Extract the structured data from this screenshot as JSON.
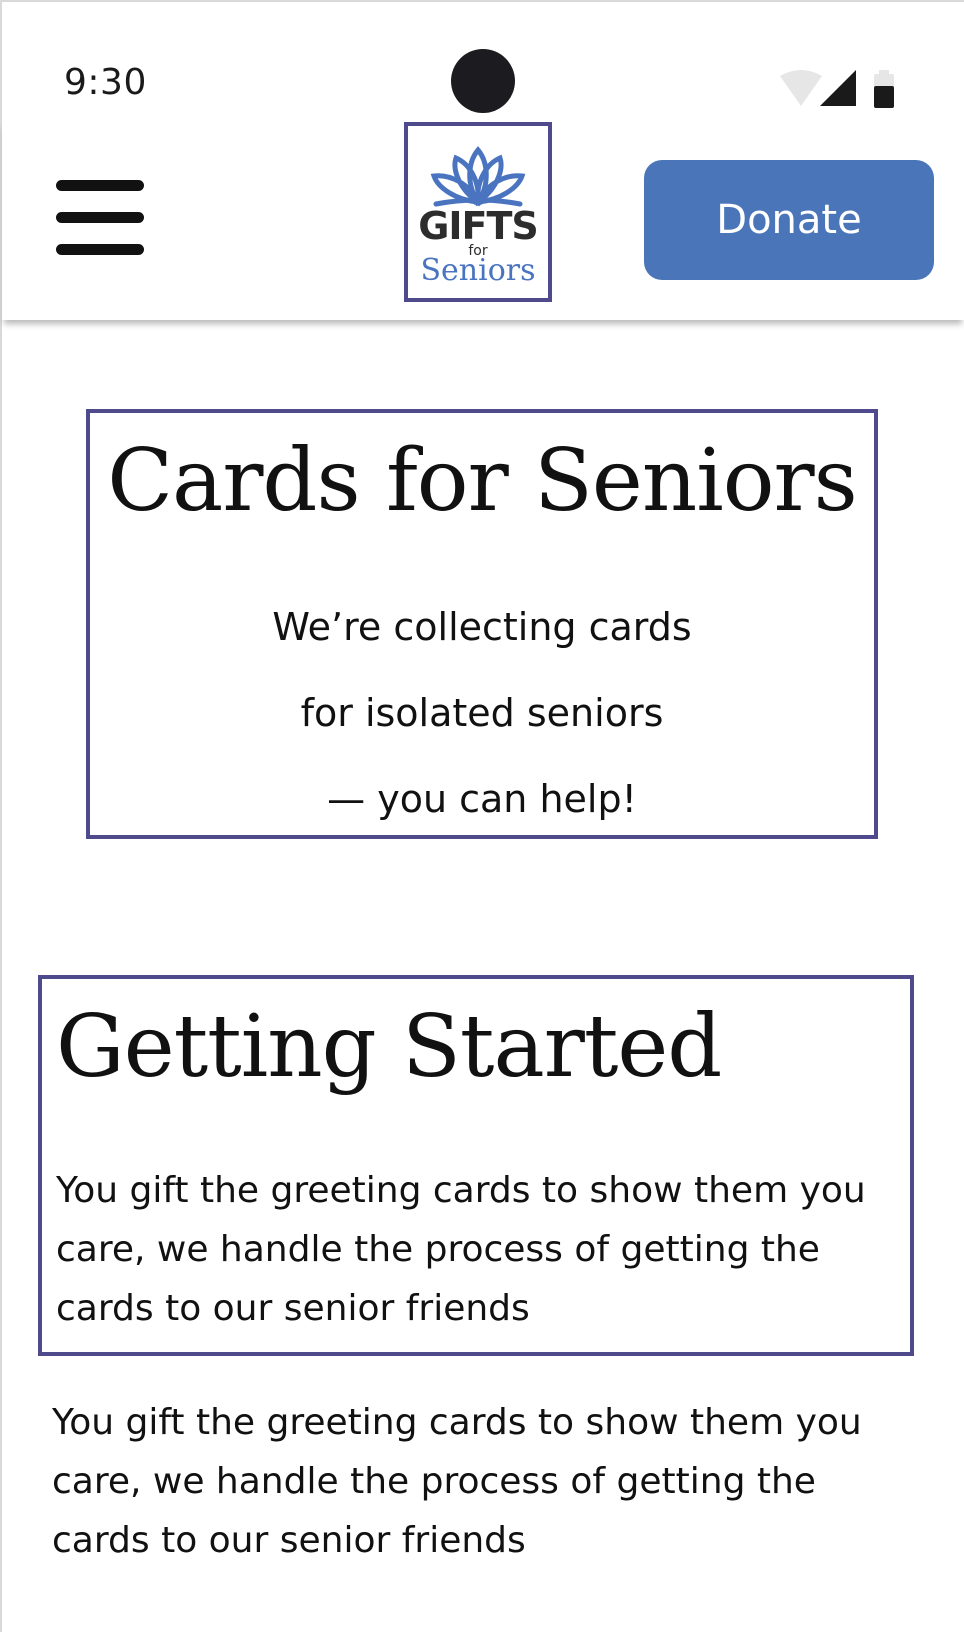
{
  "status_bar": {
    "time": "9:30",
    "icons": [
      "wifi-icon",
      "signal-icon",
      "battery-icon"
    ]
  },
  "header": {
    "menu_icon": "hamburger-menu-icon",
    "logo": {
      "line1": "GIFTS",
      "line2": "for",
      "line3": "Seniors"
    },
    "donate_label": "Donate"
  },
  "hero": {
    "title": "Cards for Seniors",
    "lines": [
      "We’re collecting cards",
      "for isolated seniors",
      "— you can help!"
    ]
  },
  "getting_started": {
    "title": "Getting Started",
    "body": "You gift the greeting cards to show them you care, we handle the process of getting the cards to our senior friends"
  },
  "body_repeat": "You gift the greeting cards to show them you care, we handle the process of getting the cards to our senior friends",
  "colors": {
    "accent": "#4a76b9",
    "outline": "#4f4a8c",
    "logo_blue": "#4a74c0"
  }
}
